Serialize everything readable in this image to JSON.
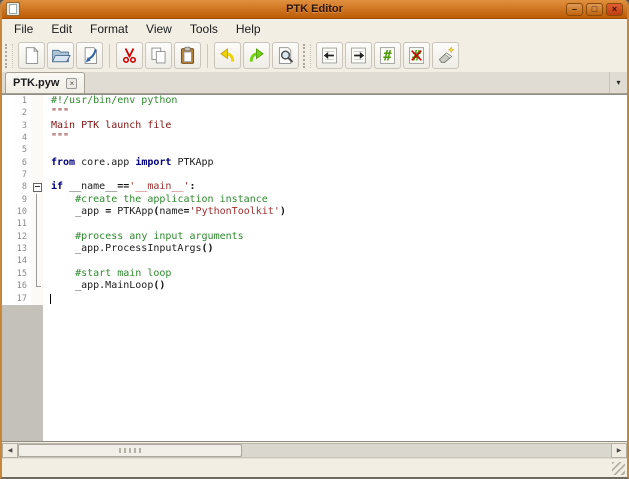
{
  "window": {
    "title": "PTK Editor",
    "controls": {
      "minimize": "–",
      "maximize": "□",
      "close": "×"
    }
  },
  "menu": {
    "items": [
      "File",
      "Edit",
      "Format",
      "View",
      "Tools",
      "Help"
    ]
  },
  "toolbar": {
    "groups": [
      {
        "buttons": [
          {
            "name": "new",
            "icon": "new-file-icon"
          },
          {
            "name": "open",
            "icon": "open-folder-icon"
          },
          {
            "name": "save",
            "icon": "save-icon"
          },
          {
            "sep": true
          },
          {
            "name": "cut",
            "icon": "cut-icon"
          },
          {
            "name": "copy",
            "icon": "copy-icon"
          },
          {
            "name": "paste",
            "icon": "paste-icon"
          },
          {
            "sep": true
          },
          {
            "name": "undo",
            "icon": "undo-icon"
          },
          {
            "name": "redo",
            "icon": "redo-icon"
          },
          {
            "name": "find",
            "icon": "find-icon"
          }
        ]
      },
      {
        "buttons": [
          {
            "name": "dedent",
            "icon": "dedent-icon"
          },
          {
            "name": "indent",
            "icon": "indent-icon"
          },
          {
            "name": "comment",
            "icon": "comment-icon"
          },
          {
            "name": "uncomment",
            "icon": "uncomment-icon"
          },
          {
            "name": "erase",
            "icon": "eraser-icon"
          }
        ]
      }
    ]
  },
  "tabbar": {
    "tabs": [
      {
        "label": "PTK.pyw",
        "active": true
      }
    ],
    "close_glyph": "×",
    "dropdown_glyph": "▾"
  },
  "editor": {
    "lines": [
      {
        "n": 1,
        "segments": [
          {
            "t": "#!/usr/bin/env python",
            "s": "comment"
          }
        ]
      },
      {
        "n": 2,
        "segments": [
          {
            "t": "\"\"\"",
            "s": "docstring"
          }
        ]
      },
      {
        "n": 3,
        "segments": [
          {
            "t": "Main PTK launch file",
            "s": "docstring"
          }
        ]
      },
      {
        "n": 4,
        "segments": [
          {
            "t": "\"\"\"",
            "s": "docstring"
          }
        ]
      },
      {
        "n": 5,
        "segments": []
      },
      {
        "n": 6,
        "segments": [
          {
            "t": "from",
            "s": "keyword"
          },
          {
            "t": " core.app ",
            "s": "plain"
          },
          {
            "t": "import",
            "s": "keyword"
          },
          {
            "t": " PTKApp",
            "s": "plain"
          }
        ]
      },
      {
        "n": 7,
        "segments": []
      },
      {
        "n": 8,
        "fold": "open",
        "segments": [
          {
            "t": "if",
            "s": "keyword"
          },
          {
            "t": " __name__",
            "s": "plain"
          },
          {
            "t": "==",
            "s": "operator"
          },
          {
            "t": "'__main__'",
            "s": "string"
          },
          {
            "t": ":",
            "s": "operator"
          }
        ]
      },
      {
        "n": 9,
        "fold": "line",
        "segments": [
          {
            "t": "    ",
            "s": "plain"
          },
          {
            "t": "#create the application instance",
            "s": "comment"
          }
        ]
      },
      {
        "n": 10,
        "fold": "line",
        "segments": [
          {
            "t": "    _app ",
            "s": "plain"
          },
          {
            "t": "=",
            "s": "operator"
          },
          {
            "t": " PTKApp",
            "s": "plain"
          },
          {
            "t": "(",
            "s": "operator"
          },
          {
            "t": "name",
            "s": "plain"
          },
          {
            "t": "=",
            "s": "operator"
          },
          {
            "t": "'PythonToolkit'",
            "s": "string"
          },
          {
            "t": ")",
            "s": "operator"
          }
        ]
      },
      {
        "n": 11,
        "fold": "line",
        "segments": []
      },
      {
        "n": 12,
        "fold": "line",
        "segments": [
          {
            "t": "    ",
            "s": "plain"
          },
          {
            "t": "#process any input arguments",
            "s": "comment"
          }
        ]
      },
      {
        "n": 13,
        "fold": "line",
        "segments": [
          {
            "t": "    _app.ProcessInputArgs",
            "s": "plain"
          },
          {
            "t": "()",
            "s": "operator"
          }
        ]
      },
      {
        "n": 14,
        "fold": "line",
        "segments": []
      },
      {
        "n": 15,
        "fold": "line",
        "segments": [
          {
            "t": "    ",
            "s": "plain"
          },
          {
            "t": "#start main loop",
            "s": "comment"
          }
        ]
      },
      {
        "n": 16,
        "fold": "end",
        "segments": [
          {
            "t": "    _app.MainLoop",
            "s": "plain"
          },
          {
            "t": "()",
            "s": "operator"
          }
        ]
      },
      {
        "n": 17,
        "caret": true,
        "segments": []
      }
    ]
  },
  "scrollbar": {
    "left_glyph": "◀",
    "right_glyph": "▶"
  },
  "colors": {
    "titlebar_top": "#E0903F",
    "titlebar_bottom": "#BE5B06",
    "titlebar_text": "#2E1604",
    "window_bg": "#F2EEE4",
    "menu_text": "#1A1A1A",
    "comment": "#2E8B2E",
    "docstring": "#7F1414",
    "string": "#A03030",
    "keyword": "#00007F",
    "plain": "#202020",
    "line_number": "#8A8A8A",
    "editor_bg": "#FFFFFF",
    "margin_below": "#C4C1BA"
  }
}
